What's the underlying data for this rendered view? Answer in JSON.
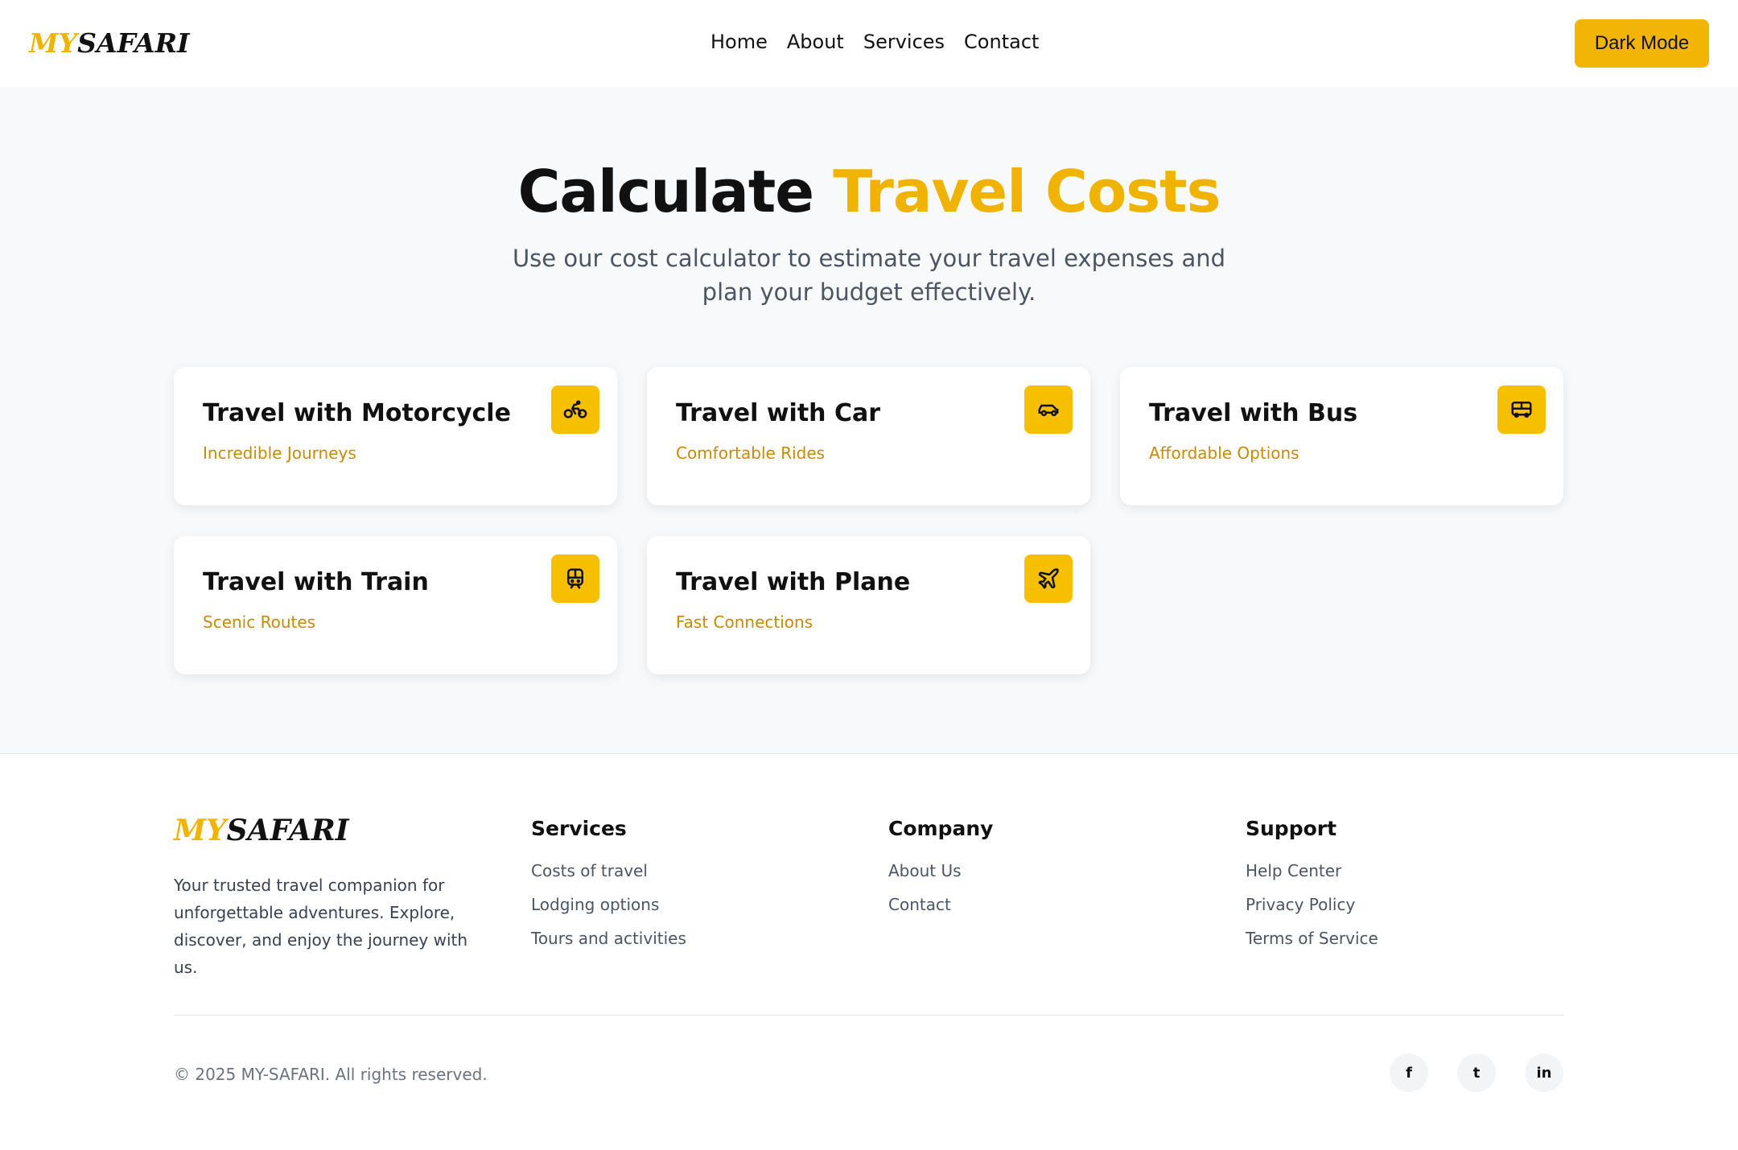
{
  "header": {
    "logo_my": "MY",
    "logo_safari": "SAFARI",
    "nav": [
      "Home",
      "About",
      "Services",
      "Contact"
    ],
    "dark_mode_label": "Dark Mode"
  },
  "hero": {
    "title_plain": "Calculate ",
    "title_accent": "Travel Costs",
    "subtitle": "Use our cost calculator to estimate your travel expenses and plan your budget effectively."
  },
  "cards": [
    {
      "title": "Travel with Motorcycle",
      "subtitle": "Incredible Journeys",
      "icon": "motorcycle-icon"
    },
    {
      "title": "Travel with Car",
      "subtitle": "Comfortable Rides",
      "icon": "car-icon"
    },
    {
      "title": "Travel with Bus",
      "subtitle": "Affordable Options",
      "icon": "bus-icon"
    },
    {
      "title": "Travel with Train",
      "subtitle": "Scenic Routes",
      "icon": "train-icon"
    },
    {
      "title": "Travel with Plane",
      "subtitle": "Fast Connections",
      "icon": "plane-icon"
    }
  ],
  "footer": {
    "logo_my": "MY",
    "logo_safari": "SAFARI",
    "about": "Your trusted travel companion for unforgettable adventures. Explore, discover, and enjoy the journey with us.",
    "columns": [
      {
        "heading": "Services",
        "links": [
          "Costs of travel",
          "Lodging options",
          "Tours and activities"
        ]
      },
      {
        "heading": "Company",
        "links": [
          "About Us",
          "Contact"
        ]
      },
      {
        "heading": "Support",
        "links": [
          "Help Center",
          "Privacy Policy",
          "Terms of Service"
        ]
      }
    ],
    "copyright": "© 2025 MY-SAFARI. All rights reserved.",
    "socials": [
      {
        "label": "f",
        "icon": "facebook-icon"
      },
      {
        "label": "t",
        "icon": "twitter-icon"
      },
      {
        "label": "in",
        "icon": "linkedin-icon"
      }
    ]
  },
  "colors": {
    "accent": "#f0b400",
    "button": "#f3b505",
    "card_subtitle": "#c98a00",
    "page_bg": "#f8f9fa"
  }
}
